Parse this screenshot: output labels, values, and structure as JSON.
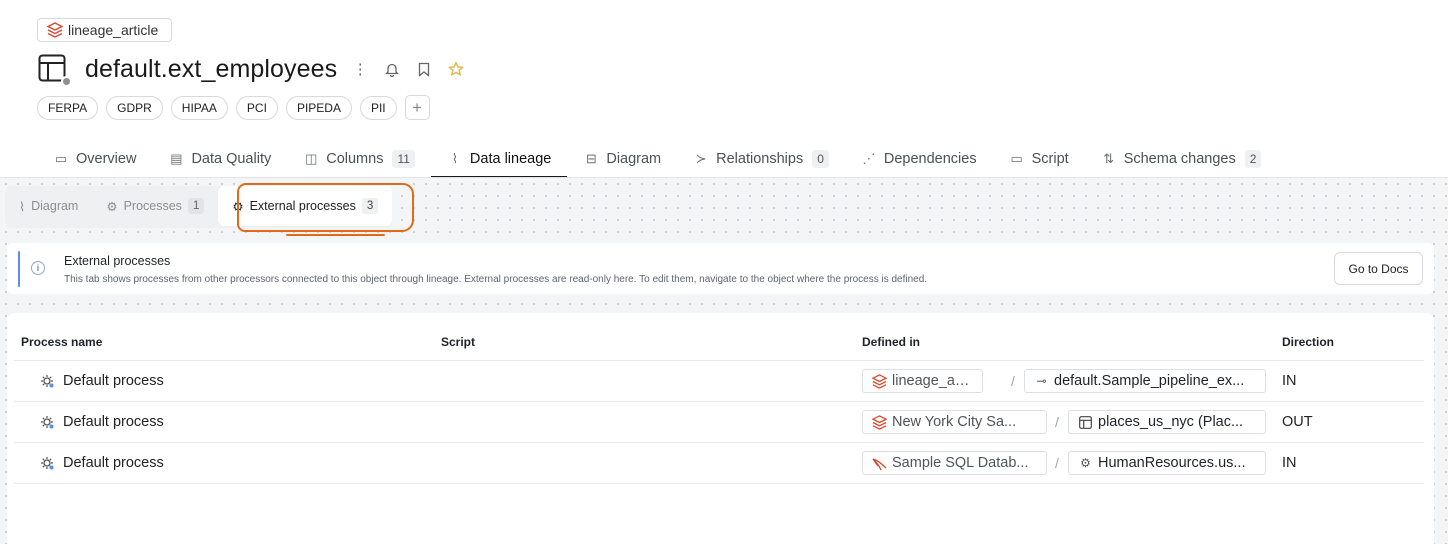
{
  "breadcrumb": {
    "label": "lineage_article",
    "icon": "database-icon"
  },
  "header": {
    "title": "default.ext_employees",
    "icon": "table-icon",
    "actions": [
      "more-icon",
      "bell-icon",
      "bookmark-icon",
      "star-icon"
    ]
  },
  "tags": [
    "FERPA",
    "GDPR",
    "HIPAA",
    "PCI",
    "PIPEDA",
    "PII"
  ],
  "main_tabs": [
    {
      "label": "Overview",
      "icon": "overview-icon"
    },
    {
      "label": "Data Quality",
      "icon": "data-quality-icon"
    },
    {
      "label": "Columns",
      "icon": "columns-icon",
      "count": "11"
    },
    {
      "label": "Data lineage",
      "icon": "lineage-icon",
      "active": true
    },
    {
      "label": "Diagram",
      "icon": "diagram-icon"
    },
    {
      "label": "Relationships",
      "icon": "relationships-icon",
      "count": "0"
    },
    {
      "label": "Dependencies",
      "icon": "dependencies-icon"
    },
    {
      "label": "Script",
      "icon": "script-icon"
    },
    {
      "label": "Schema changes",
      "icon": "schema-changes-icon",
      "count": "2"
    }
  ],
  "sub_tabs": [
    {
      "label": "Diagram",
      "icon": "lineage-icon"
    },
    {
      "label": "Processes",
      "icon": "gear-icon",
      "count": "1"
    },
    {
      "label": "External processes",
      "icon": "gear-icon",
      "count": "3",
      "active": true
    }
  ],
  "info": {
    "title": "External processes",
    "text": "This tab shows processes from other processors connected to this object through lineage. External processes are read-only here. To edit them, navigate to the object where the process is defined.",
    "button": "Go to Docs"
  },
  "table": {
    "headers": [
      "Process name",
      "Script",
      "Defined in",
      "Direction"
    ],
    "rows": [
      {
        "name": "Default process",
        "script": "",
        "source": "lineage_article",
        "source_icon": "database-icon",
        "object": "default.Sample_pipeline_ex...",
        "object_icon": "pipeline-icon",
        "direction": "IN"
      },
      {
        "name": "Default process",
        "script": "",
        "source": "New York City Sa...",
        "source_icon": "database-icon",
        "object": "places_us_nyc (Plac...",
        "object_icon": "table-icon",
        "direction": "OUT"
      },
      {
        "name": "Default process",
        "script": "",
        "source": "Sample SQL Datab...",
        "source_icon": "sql-server-icon",
        "object": "HumanResources.us...",
        "object_icon": "gear-icon",
        "direction": "IN"
      }
    ],
    "separator": "/"
  },
  "colors": {
    "accent_highlight": "#e36a1b",
    "info_bar": "#5b8def",
    "db_icon": "#d9472b"
  }
}
